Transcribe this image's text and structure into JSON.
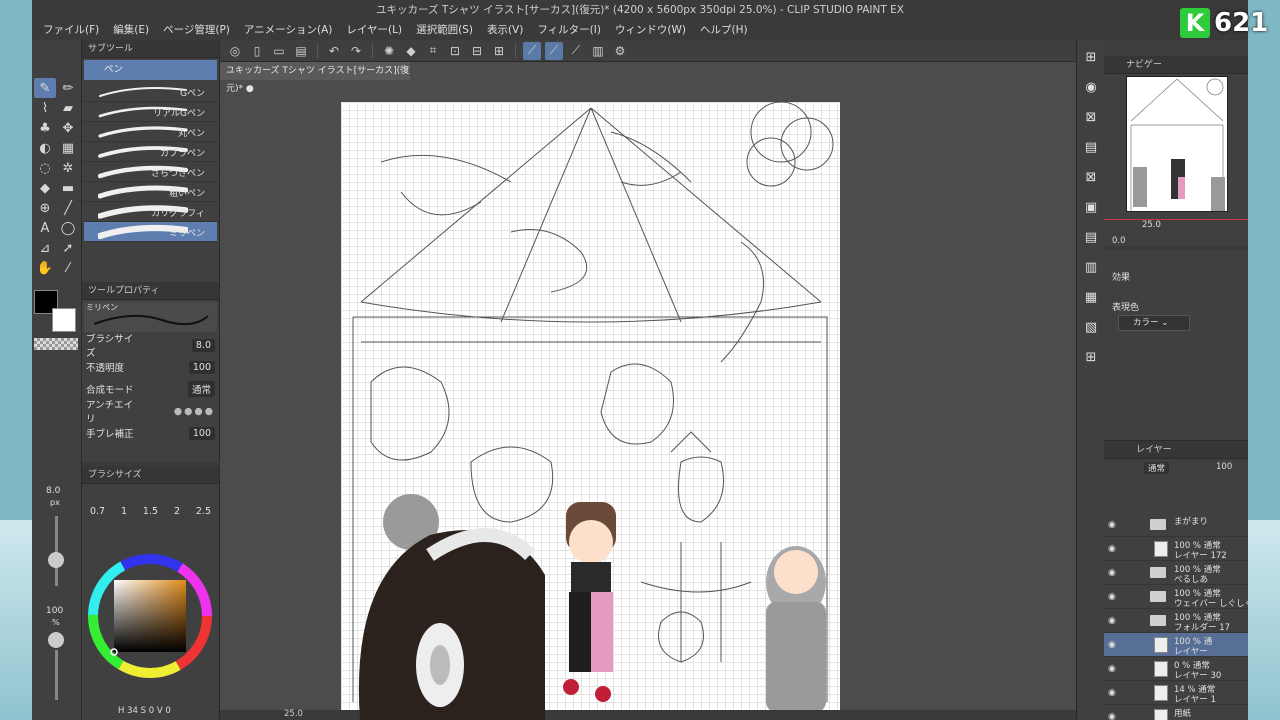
{
  "window": {
    "title": "ユキッカーズ Tシャツ イラスト[サーカス](復元)* (4200 x 5600px 350dpi 25.0%) - CLIP STUDIO PAINT EX"
  },
  "menu": [
    "ファイル(F)",
    "編集(E)",
    "ページ管理(P)",
    "アニメーション(A)",
    "レイヤー(L)",
    "選択範囲(S)",
    "表示(V)",
    "フィルター(I)",
    "ウィンドウ(W)",
    "ヘルプ(H)"
  ],
  "document": {
    "tab": "ユキッカーズ Tシャツ イラスト[サーカス](復元)*"
  },
  "subtool": {
    "header": "サブツール",
    "group": "ペン",
    "brushes": [
      "Gペン",
      "リアルGペン",
      "丸ペン",
      "カブラペン",
      "ざらつきペン",
      "粗いペン",
      "カリグラフィ",
      "ミリペン"
    ],
    "selected": 7
  },
  "toolprop": {
    "header": "ツールプロパティ",
    "brush_name": "ミリペン",
    "rows": [
      {
        "label": "ブラシサイズ",
        "value": "8.0"
      },
      {
        "label": "不透明度",
        "value": "100"
      },
      {
        "label": "合成モード",
        "value": "通常"
      },
      {
        "label": "アンチエイリ",
        "value": ""
      },
      {
        "label": "手ブレ補正",
        "value": "100"
      }
    ]
  },
  "brushsize": {
    "header": "ブラシサイズ",
    "values": [
      "0.7",
      "1",
      "1.5",
      "2",
      "2.5"
    ]
  },
  "leftcol": {
    "size_val": "8.0",
    "size_unit": "px",
    "opacity_val": "100",
    "opacity_unit": "%"
  },
  "color": {
    "readout": "H 34 S 0 V 0",
    "main_color": "#000000",
    "sub_color": "#ffffff"
  },
  "navigator": {
    "header": "ナビゲー",
    "zoom": "25.0",
    "angle": "0.0"
  },
  "effect": {
    "header": "効果",
    "expression_label": "表現色",
    "expression_value": "カラー"
  },
  "layers": {
    "header": "レイヤー",
    "blend": "通常",
    "opacity": "100",
    "rows": [
      {
        "line1": "まがまり",
        "line2": "",
        "type": "folder",
        "selected": false
      },
      {
        "line1": "100 % 通常",
        "line2": "レイヤー 172",
        "type": "layer",
        "selected": false
      },
      {
        "line1": "100 % 通常",
        "line2": "ぺるしあ",
        "type": "folder",
        "selected": false
      },
      {
        "line1": "100 % 通常",
        "line2": "ウェイバー しぐしぐ",
        "type": "folder",
        "selected": false
      },
      {
        "line1": "100 % 通常",
        "line2": "フォルダー 17",
        "type": "folder",
        "selected": false
      },
      {
        "line1": "100 % 通",
        "line2": "レイヤー",
        "type": "layer",
        "selected": true
      },
      {
        "line1": "0 % 通常",
        "line2": "レイヤー 30",
        "type": "layer",
        "selected": false
      },
      {
        "line1": "14 % 通常",
        "line2": "レイヤー 1",
        "type": "layer",
        "selected": false
      },
      {
        "line1": "用紙",
        "line2": "",
        "type": "paper",
        "selected": false
      }
    ]
  },
  "statusbar": {
    "zoom": "25.0"
  },
  "overlay": {
    "letter": "K",
    "count": "621"
  },
  "colors": {
    "accent": "#5e7eb0",
    "panel": "#404040",
    "dark": "#3a3a3a"
  }
}
